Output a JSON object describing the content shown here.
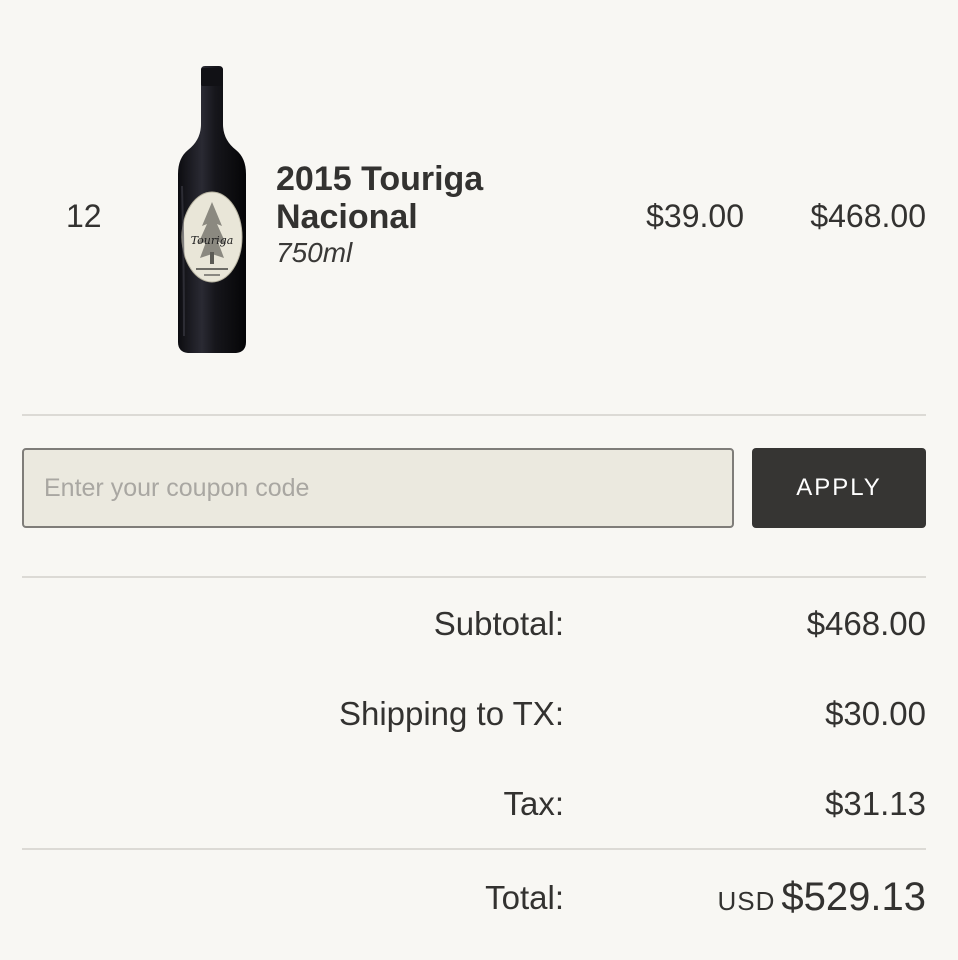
{
  "cart_item": {
    "quantity": "12",
    "name": "2015 Touriga Nacional",
    "size": "750ml",
    "unit_price": "$39.00",
    "line_total": "$468.00"
  },
  "coupon": {
    "placeholder": "Enter your coupon code",
    "value": "",
    "apply_label": "APPLY"
  },
  "summary": {
    "subtotal_label": "Subtotal:",
    "subtotal_value": "$468.00",
    "shipping_label": "Shipping to TX:",
    "shipping_value": "$30.00",
    "tax_label": "Tax:",
    "tax_value": "$31.13",
    "total_label": "Total:",
    "total_currency": "USD",
    "total_value": "$529.13"
  },
  "colors": {
    "background": "#f8f7f3",
    "text": "#333230",
    "button": "#363533",
    "input_background": "#ebe9df",
    "divider": "#dcdad5"
  }
}
